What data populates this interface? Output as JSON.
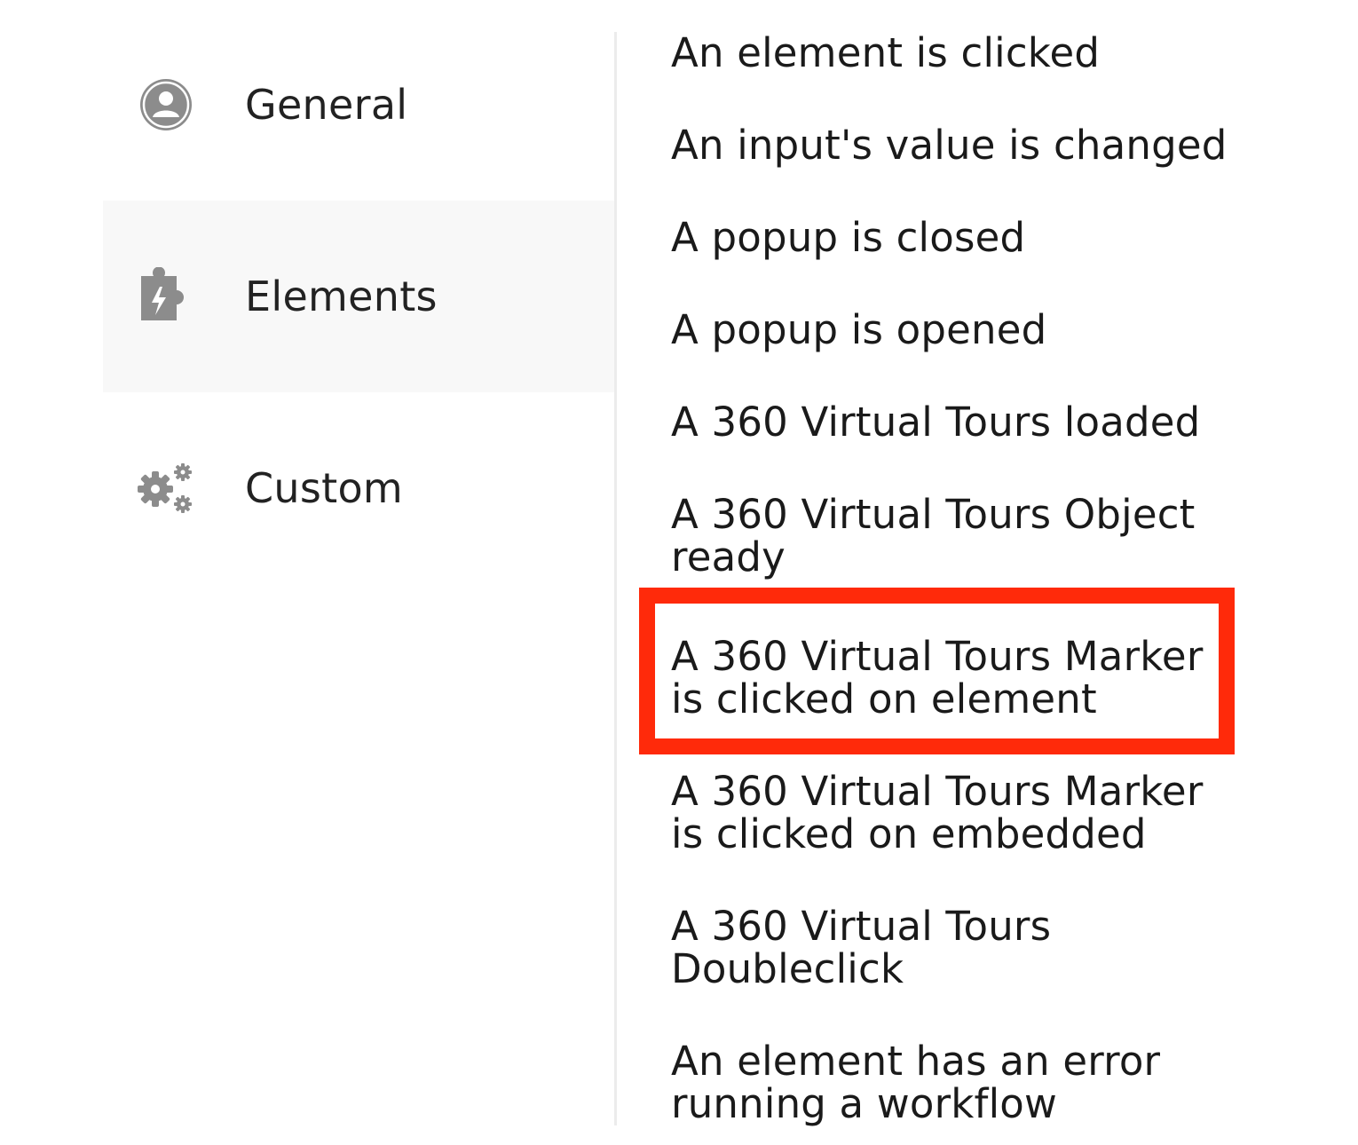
{
  "sidebar": {
    "items": [
      {
        "label": "General",
        "icon": "user-icon",
        "active": false
      },
      {
        "label": "Elements",
        "icon": "puzzle-icon",
        "active": true
      },
      {
        "label": "Custom",
        "icon": "gears-icon",
        "active": false
      }
    ]
  },
  "events": {
    "items": [
      "An element is clicked",
      "An input's value is changed",
      "A popup is closed",
      "A popup is opened",
      "A 360 Virtual Tours loaded",
      "A 360 Virtual Tours Object ready",
      "A 360 Virtual Tours Marker is clicked on element",
      "A 360 Virtual Tours Marker is clicked on embedded",
      "A 360 Virtual Tours Doubleclick",
      "An element has an error running a workflow"
    ],
    "highlighted_index": 6
  },
  "colors": {
    "highlight_border": "#ff2a0a",
    "active_background": "#f8f8f8",
    "icon_gray": "#8c8c8c"
  }
}
